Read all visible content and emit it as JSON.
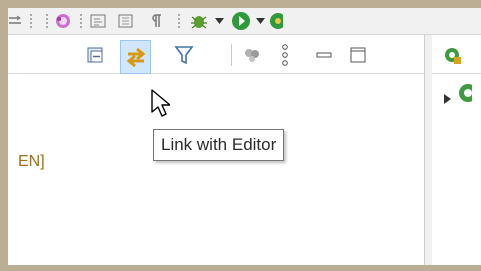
{
  "main_toolbar": {
    "icons": [
      "team-sync-icon",
      "overflow-dots-icon",
      "plugin-icon",
      "toggle-structure-icon",
      "block-selection-icon",
      "show-whitespace-icon",
      "debug-icon",
      "dropdown-arrow-icon",
      "run-icon",
      "dropdown-arrow-icon",
      "coverage-icon"
    ]
  },
  "view": {
    "toolbar_icons": [
      "collapse-all-icon",
      "link-with-editor-icon",
      "filter-icon",
      "focus-icon",
      "view-menu-icon",
      "minimize-icon",
      "maximize-icon"
    ],
    "content_text": "EN]"
  },
  "tooltip": {
    "text": "Link with Editor"
  },
  "right_view": {
    "icons": [
      "package-icon",
      "expand-arrow-icon",
      "class-icon"
    ]
  }
}
